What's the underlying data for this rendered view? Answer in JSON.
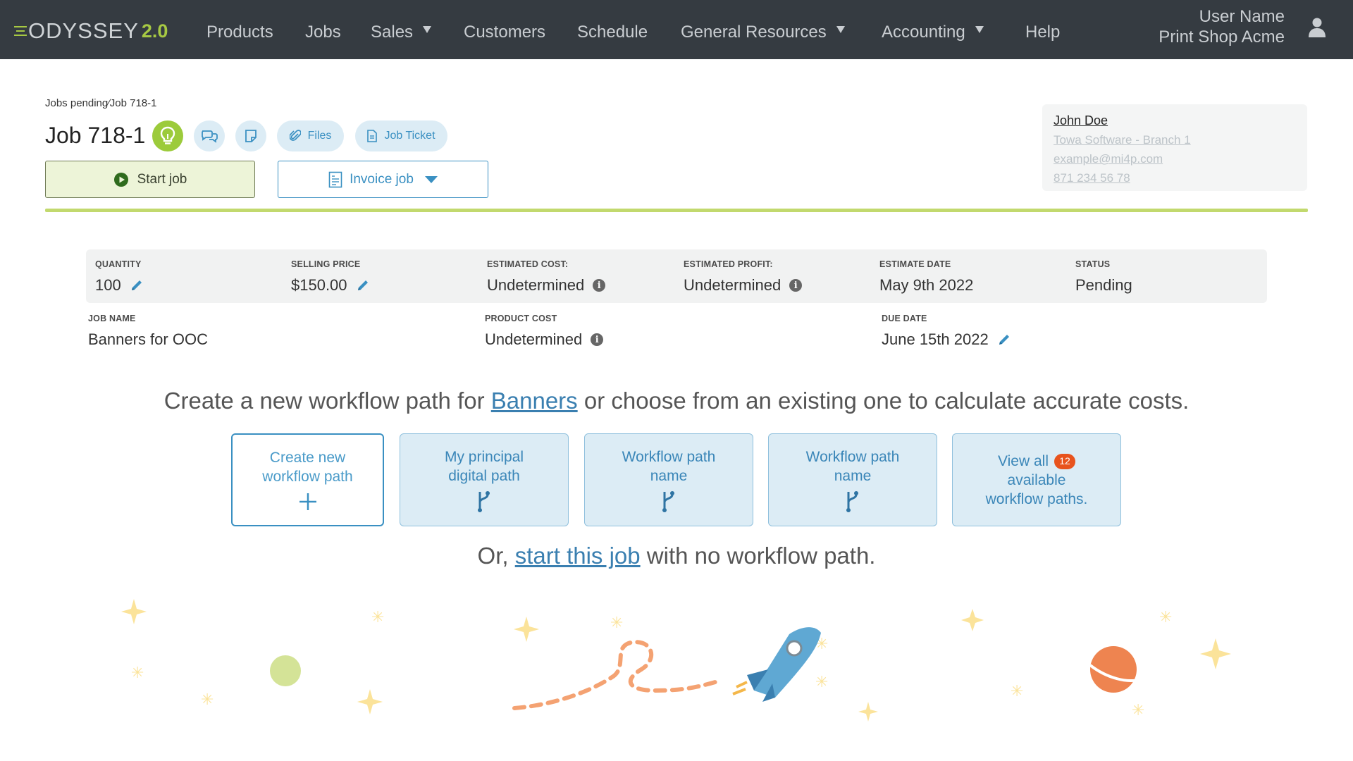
{
  "app": {
    "logo_text": "ODYSSEY",
    "logo_version": "2.0"
  },
  "nav": {
    "items": [
      {
        "label": "Products"
      },
      {
        "label": "Jobs"
      },
      {
        "label": "Sales"
      },
      {
        "label": "Customers"
      },
      {
        "label": "Schedule"
      },
      {
        "label": "General Resources"
      },
      {
        "label": "Accounting"
      },
      {
        "label": "Help"
      }
    ],
    "user_name": "User Name",
    "shop_name": "Print Shop Acme"
  },
  "page": {
    "breadcrumb": "Jobs pending∕Job 718-1",
    "job_title": "Job 718-1",
    "files_label": "Files",
    "job_ticket_label": "Job Ticket",
    "start_job_label": "Start job",
    "invoice_job_label": "Invoice job"
  },
  "contact": {
    "name": "John Doe",
    "company": "Towa Software - Branch 1",
    "email": "example@mi4p.com",
    "phone": "871 234 56 78"
  },
  "stats": {
    "quantity_label": "QUANTITY",
    "quantity_value": "100",
    "selling_price_label": "SELLING PRICE",
    "selling_price_value": "$150.00",
    "estimated_cost_label": "ESTIMATED COST:",
    "estimated_cost_value": "Undetermined",
    "estimated_profit_label": "ESTIMATED PROFIT:",
    "estimated_profit_value": "Undetermined",
    "estimate_date_label": "ESTIMATE DATE",
    "estimate_date_value": "May 9th 2022",
    "status_label": "STATUS",
    "status_value": "Pending",
    "job_name_label": "JOB NAME",
    "job_name_value": "Banners for OOC",
    "product_cost_label": "PRODUCT COST",
    "product_cost_value": "Undetermined",
    "due_date_label": "DUE DATE",
    "due_date_value": "June 15th 2022"
  },
  "workflow": {
    "headline_pre": "Create a new workflow path for ",
    "headline_link": "Banners",
    "headline_post": " or choose from an existing one to calculate accurate costs.",
    "create_line1": "Create new",
    "create_line2": "workflow path",
    "path1_line1": "My principal",
    "path1_line2": "digital path",
    "path2_line1": "Workflow path",
    "path2_line2": "name",
    "path3_line1": "Workflow path",
    "path3_line2": "name",
    "view_all_label": "View all",
    "view_all_count": "12",
    "view_all_line2": "available",
    "view_all_line3": "workflow paths.",
    "sub_pre": "Or, ",
    "sub_link": "start this job",
    "sub_post": " with no workflow path."
  },
  "colors": {
    "nav_bg": "#353b41",
    "accent_green": "#a7c943",
    "accent_blue": "#3a90c2",
    "badge_orange": "#e8531d"
  }
}
